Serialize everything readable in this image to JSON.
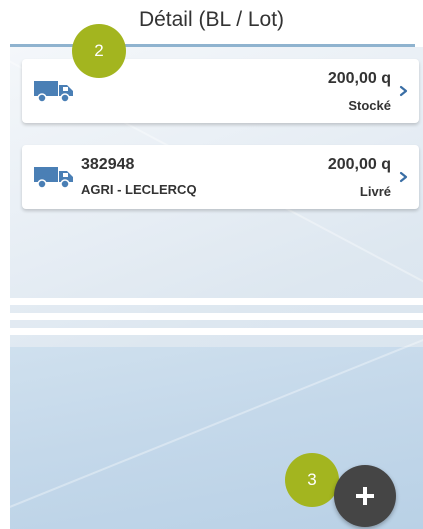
{
  "header": {
    "title": "Détail (BL / Lot)"
  },
  "items": [
    {
      "ref": "",
      "client": "",
      "quantity": "200,00 q",
      "status": "Stocké"
    },
    {
      "ref": "382948",
      "client": "AGRI - LECLERCQ",
      "quantity": "200,00 q",
      "status": "Livré"
    }
  ],
  "badges": {
    "b2": "2",
    "b3": "3"
  },
  "icons": {
    "item": "truck-icon",
    "chevron": "chevron-right-icon",
    "fab": "plus-icon"
  },
  "colors": {
    "badge": "#a3b51f",
    "truck": "#4a7fb5",
    "fab": "#454545",
    "header_line": "#8fb3cf"
  }
}
